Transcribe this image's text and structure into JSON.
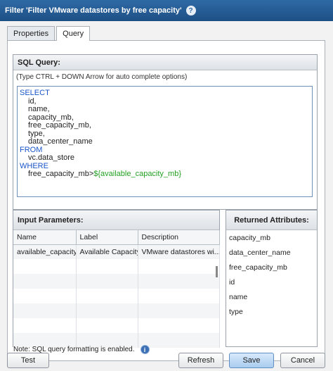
{
  "window": {
    "title": "Filter 'Filter VMware datastores by free capacity'"
  },
  "tabs": [
    {
      "label": "Properties",
      "active": false
    },
    {
      "label": "Query",
      "active": true
    }
  ],
  "sql": {
    "header": "SQL Query:",
    "hint": "(Type CTRL + DOWN Arrow for auto complete options)",
    "lines": {
      "select": "SELECT",
      "col1": "id,",
      "col2": "name,",
      "col3": "capacity_mb,",
      "col4": "free_capacity_mb,",
      "col5": "type,",
      "col6": "data_center_name",
      "from": "FROM",
      "table": "vc.data_store",
      "where": "WHERE",
      "cond_left": "free_capacity_mb>",
      "cond_var": "${available_capacity_mb}"
    }
  },
  "input_parameters": {
    "header": "Input Parameters:",
    "columns": [
      "Name",
      "Label",
      "Description"
    ],
    "row": {
      "name": "available_capacity_",
      "label": "Available Capacity",
      "description": "VMware datastores wi..."
    }
  },
  "returned_attributes": {
    "header": "Returned Attributes:",
    "items": [
      "capacity_mb",
      "data_center_name",
      "free_capacity_mb",
      "id",
      "name",
      "type"
    ]
  },
  "note": "Note: SQL query formatting is enabled.",
  "buttons": {
    "test": "Test",
    "refresh": "Refresh",
    "save": "Save",
    "cancel": "Cancel"
  }
}
